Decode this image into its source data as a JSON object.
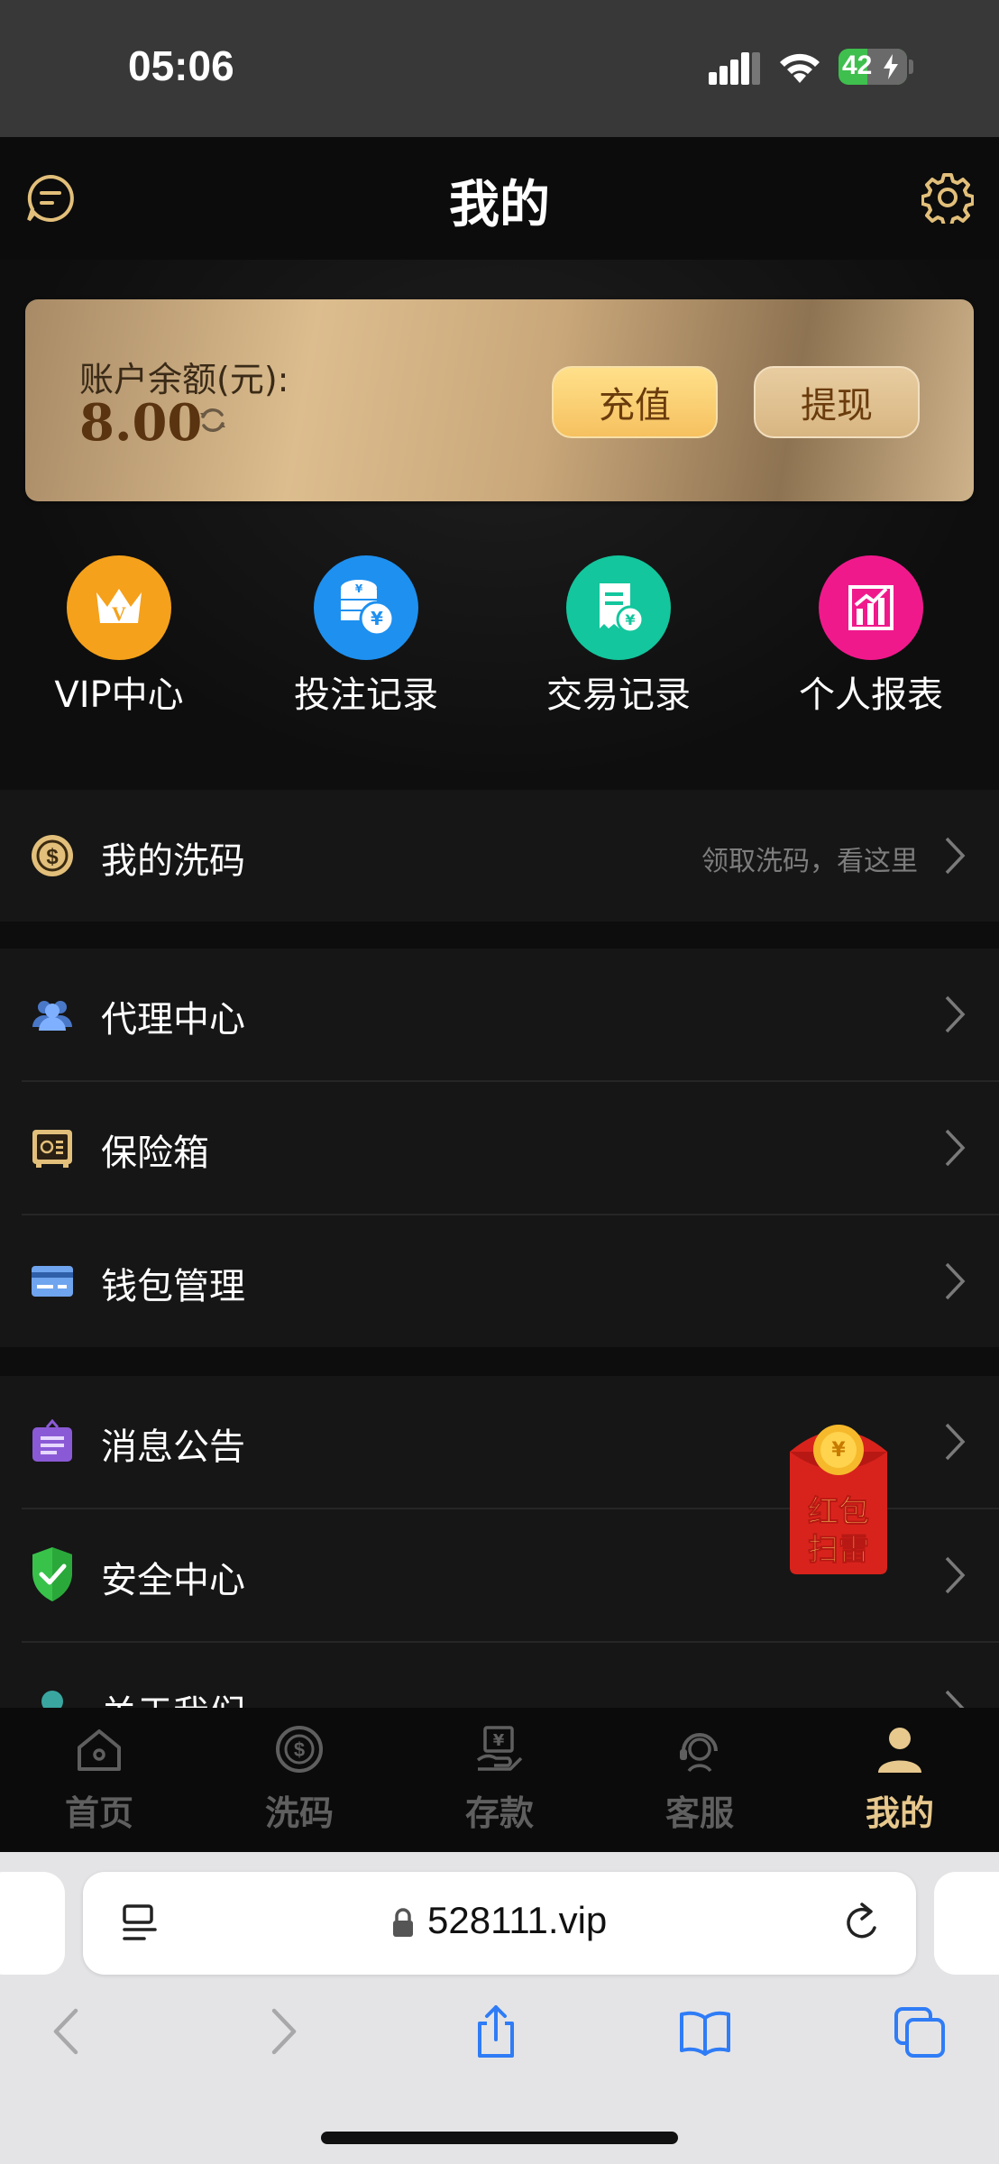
{
  "status_bar": {
    "time": "05:06",
    "battery_percent": "42",
    "battery_level": 0.42
  },
  "header": {
    "title": "我的"
  },
  "balance": {
    "label": "账户余额(元):",
    "value": "8.00",
    "recharge_label": "充值",
    "withdraw_label": "提现"
  },
  "quick_actions": [
    {
      "label": "VIP中心",
      "icon": "vip-crown-icon",
      "color": "#f5a11b"
    },
    {
      "label": "投注记录",
      "icon": "coins-stack-icon",
      "color": "#1e90f0"
    },
    {
      "label": "交易记录",
      "icon": "receipt-icon",
      "color": "#13c69d"
    },
    {
      "label": "个人报表",
      "icon": "bar-chart-icon",
      "color": "#f0198c"
    }
  ],
  "menu": {
    "rebate": {
      "label": "我的洗码",
      "hint": "领取洗码，看这里"
    },
    "group1": [
      {
        "label": "代理中心",
        "icon": "users-icon"
      },
      {
        "label": "保险箱",
        "icon": "safe-icon"
      },
      {
        "label": "钱包管理",
        "icon": "wallet-card-icon"
      }
    ],
    "group2": [
      {
        "label": "消息公告",
        "icon": "notice-icon"
      },
      {
        "label": "安全中心",
        "icon": "shield-check-icon"
      },
      {
        "label": "关于我们",
        "icon": "about-icon"
      }
    ]
  },
  "red_packet": {
    "line1": "红包",
    "line2": "扫雷"
  },
  "tab_bar": [
    {
      "label": "首页",
      "icon": "home-icon",
      "active": false
    },
    {
      "label": "洗码",
      "icon": "dollar-target-icon",
      "active": false
    },
    {
      "label": "存款",
      "icon": "deposit-icon",
      "active": false
    },
    {
      "label": "客服",
      "icon": "support-agent-icon",
      "active": false
    },
    {
      "label": "我的",
      "icon": "user-icon",
      "active": true
    }
  ],
  "browser": {
    "url": "528111.vip"
  }
}
